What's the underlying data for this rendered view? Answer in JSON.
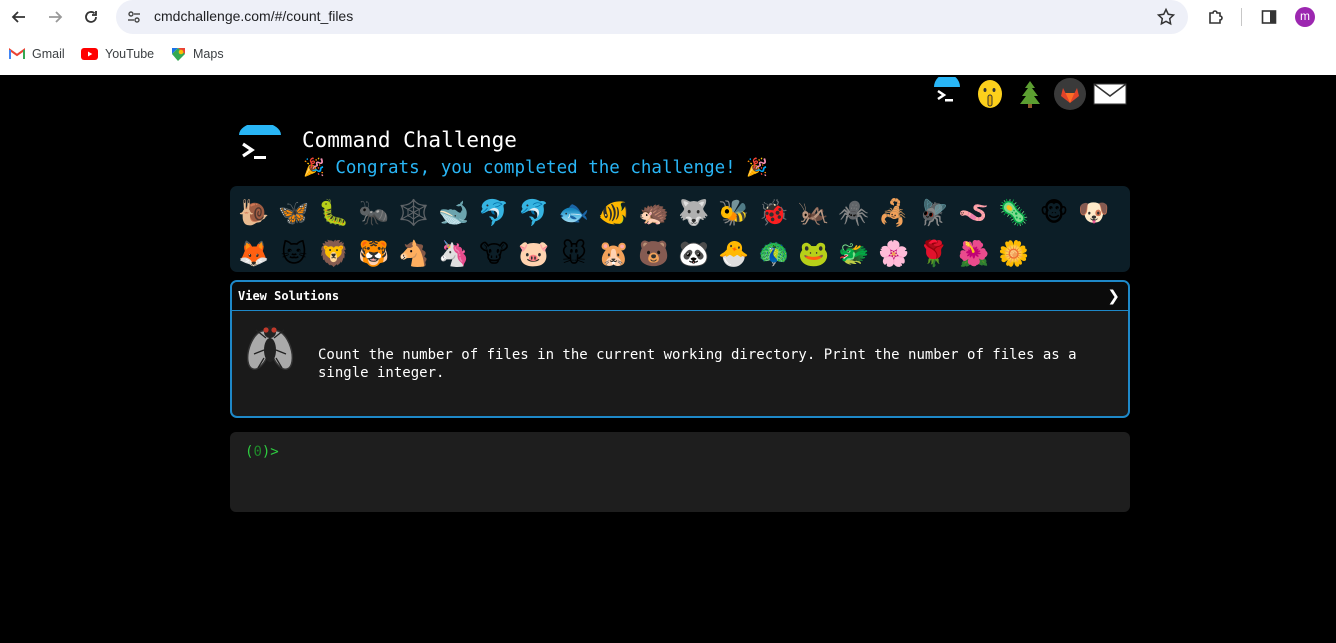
{
  "browser": {
    "url": "cmdchallenge.com/#/count_files",
    "profile_initial": "m",
    "bookmarks": [
      {
        "label": "Gmail",
        "icon": "gmail-icon"
      },
      {
        "label": "YouTube",
        "icon": "youtube-icon"
      },
      {
        "label": "Maps",
        "icon": "maps-icon"
      }
    ]
  },
  "header": {
    "title": "Command Challenge",
    "congrats": "Congrats, you completed the challenge!",
    "party_emoji": "🎉",
    "top_icons": [
      "terminal-logo-icon",
      "shushing-face-icon",
      "christmas-tree-icon",
      "gitlab-icon",
      "envelope-icon"
    ]
  },
  "animals": [
    "🐌",
    "🦋",
    "🐛",
    "🐜",
    "🕸️",
    "🐋",
    "🐬",
    "🐬",
    "🐟",
    "🐠",
    "🦔",
    "🐺",
    "🐝",
    "🐞",
    "🦗",
    "🕷️",
    "🦂",
    "🪰",
    "🪱",
    "🦠",
    "🐵",
    "🐶",
    "🦊",
    "🐱",
    "🦁",
    "🐯",
    "🐴",
    "🦄",
    "🐮",
    "🐷",
    "🐭",
    "🐹",
    "🐻",
    "🐼",
    "🐣",
    "🦚",
    "🐸",
    "🐲",
    "🌸",
    "🌹",
    "🌺",
    "🌼"
  ],
  "solutions": {
    "label": "View Solutions",
    "chevron": "❯",
    "challenge_icon": "fly-icon",
    "description": "Count the number of files in the current working directory. Print the number of files as a single integer."
  },
  "terminal": {
    "prompt_open": "(",
    "prompt_count": "0",
    "prompt_close": ")>"
  },
  "colors": {
    "accent": "#29b6f6",
    "border": "#1e88c8",
    "prompt": "#2ecc40"
  }
}
